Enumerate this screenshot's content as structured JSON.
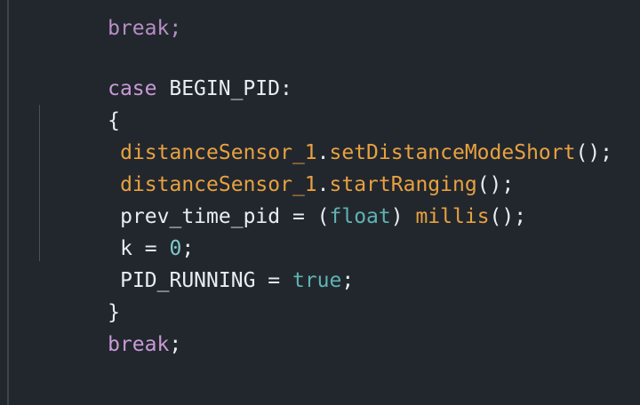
{
  "code": {
    "top_fragment": "break;",
    "case_keyword": "case",
    "case_label": "BEGIN_PID:",
    "open_brace": "{",
    "line1": {
      "object": "distanceSensor_1",
      "dot": ".",
      "method": "setDistanceModeShort",
      "tail": "();"
    },
    "line2": {
      "object": "distanceSensor_1",
      "dot": ".",
      "method": "startRanging",
      "tail": "();"
    },
    "line3": {
      "lhs": "prev_time_pid = (",
      "type": "float",
      "mid": ") ",
      "call": "millis",
      "tail": "();"
    },
    "line4": {
      "lhs": "k = ",
      "value": "0",
      "tail": ";"
    },
    "line5": {
      "lhs": "PID_RUNNING = ",
      "value": "true",
      "tail": ";"
    },
    "close_brace": "}",
    "break_keyword": "break",
    "break_tail": ";"
  },
  "colors": {
    "background": "#22272e",
    "keyword": "#c89ad6",
    "function": "#e8a13f",
    "type": "#5fb3b3",
    "number": "#7fc8c8",
    "text": "#e6edf3"
  }
}
